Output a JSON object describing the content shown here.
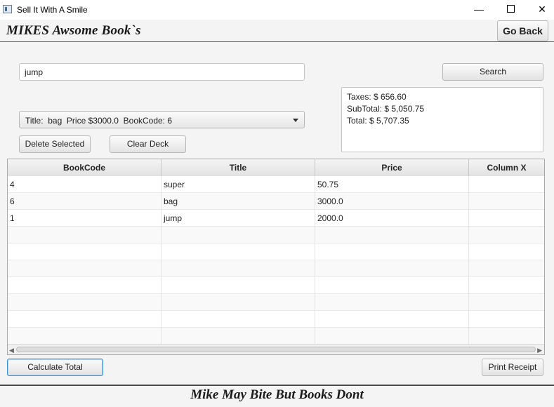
{
  "window": {
    "title": "Sell It With A Smile",
    "minimize": "—",
    "close": "✕"
  },
  "header": {
    "brand": "MIKES Awsome Book`s",
    "go_back_label": "Go Back"
  },
  "search": {
    "value": "jump",
    "button_label": "Search"
  },
  "totals": {
    "taxes": "Taxes: $ 656.60",
    "subtotal": "SubTotal: $ 5,050.75",
    "total": "Total: $ 5,707.35"
  },
  "selection": {
    "selected": "Title:  bag  Price $3000.0  BookCode: 6"
  },
  "actions": {
    "delete_label": "Delete Selected",
    "clear_label": "Clear Deck",
    "calculate_label": "Calculate Total",
    "print_label": "Print Receipt"
  },
  "table": {
    "columns": [
      "BookCode",
      "Title",
      "Price",
      "Column X"
    ],
    "rows": [
      [
        "4",
        "super",
        "50.75",
        ""
      ],
      [
        "6",
        "bag",
        "3000.0",
        ""
      ],
      [
        "1",
        "jump",
        "2000.0",
        ""
      ]
    ]
  },
  "footer": {
    "tagline": "Mike May Bite But Books Dont"
  },
  "icons": {
    "app": "app-window-icon",
    "dropdown": "chevron-down-icon",
    "scroll_left": "arrow-left-icon",
    "scroll_right": "arrow-right-icon"
  },
  "colors": {
    "focus_border": "#3b8fd6",
    "background": "#f4f4f4"
  }
}
